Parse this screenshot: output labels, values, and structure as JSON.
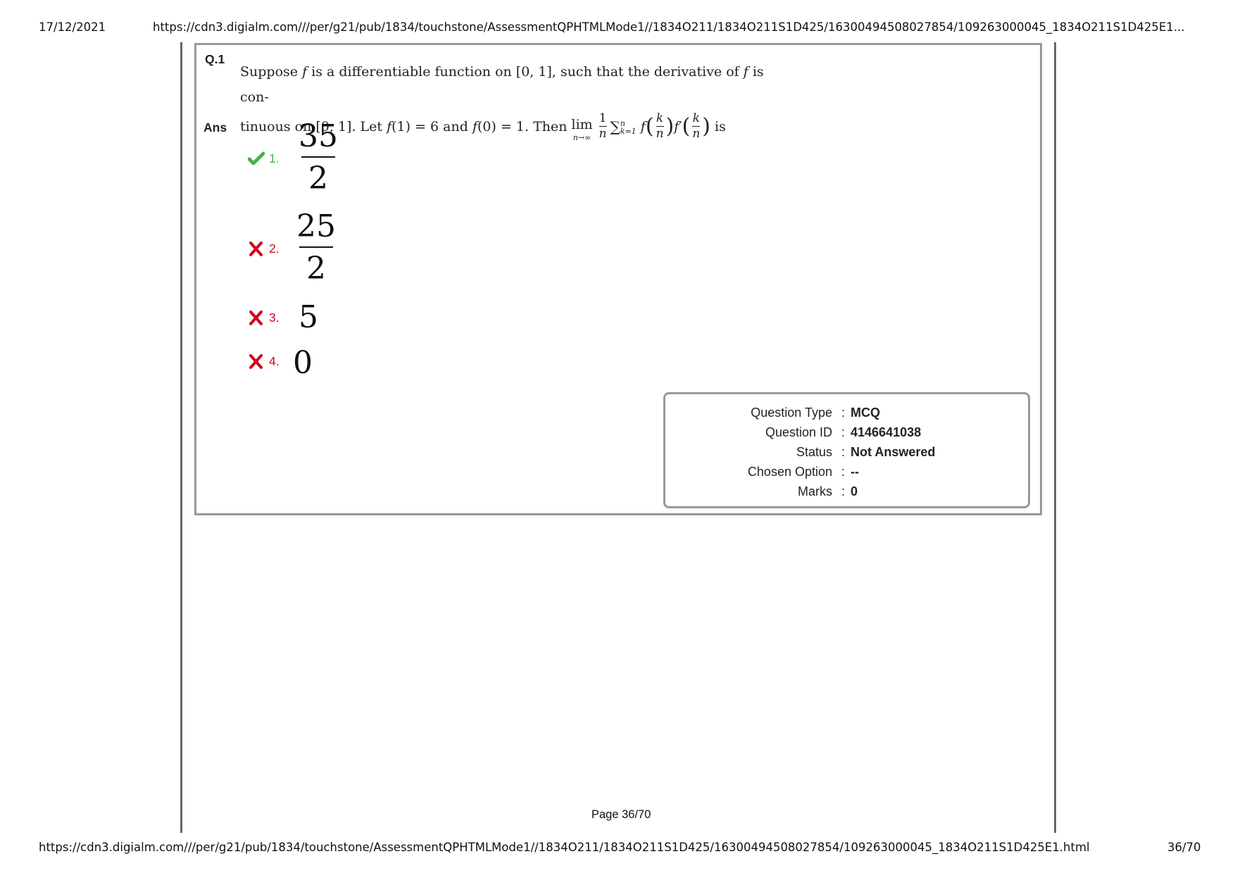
{
  "print_header": {
    "date": "17/12/2021",
    "url": "https://cdn3.digialm.com///per/g21/pub/1834/touchstone/AssessmentQPHTMLMode1//1834O211/1834O211S1D425/16300494508027854/109263000045_1834O211S1D425E1..."
  },
  "print_footer": {
    "url": "https://cdn3.digialm.com///per/g21/pub/1834/touchstone/AssessmentQPHTMLMode1//1834O211/1834O211S1D425/16300494508027854/109263000045_1834O211S1D425E1.html",
    "page": "36/70"
  },
  "page_label": "Page 36/70",
  "question": {
    "number": "Q.1",
    "ans_label": "Ans",
    "text_line1_parts": [
      "Suppose ",
      "f",
      " is a differentiable function on [0, 1], such that the derivative of ",
      "f",
      " is con-"
    ],
    "text_line2_prefix": "tinuous on [0, 1]. Let ",
    "f1": "f",
    "f1_expr": "(1) = 6 and ",
    "f0": "f",
    "f0_expr": "(0) = 1. Then ",
    "lim_word": "lim",
    "lim_sub": "n→∞",
    "frac_num": "1",
    "frac_den": "n",
    "sum_symbol": "∑",
    "sum_sup": "n",
    "sum_sub": "k=1",
    "func1": "f",
    "func2": "f′",
    "inner_num": "k",
    "inner_den": "n",
    "suffix": " is"
  },
  "options": [
    {
      "number": "1.",
      "status": "correct",
      "icon": "check-icon",
      "numerator": "35",
      "denominator": "2"
    },
    {
      "number": "2.",
      "status": "wrong",
      "icon": "cross-icon",
      "numerator": "25",
      "denominator": "2"
    },
    {
      "number": "3.",
      "status": "wrong",
      "icon": "cross-icon",
      "value": "5"
    },
    {
      "number": "4.",
      "status": "wrong",
      "icon": "cross-icon",
      "value": "0"
    }
  ],
  "info": {
    "rows": [
      {
        "label": "Question Type",
        "value": "MCQ"
      },
      {
        "label": "Question ID",
        "value": "4146641038"
      },
      {
        "label": "Status",
        "value": "Not Answered"
      },
      {
        "label": "Chosen Option",
        "value": "--"
      },
      {
        "label": "Marks",
        "value": "0"
      }
    ],
    "separator": ":"
  },
  "colors": {
    "correct": "#4caf50",
    "wrong": "#d0021b",
    "box_border": "#999999",
    "page_border": "#666666"
  }
}
